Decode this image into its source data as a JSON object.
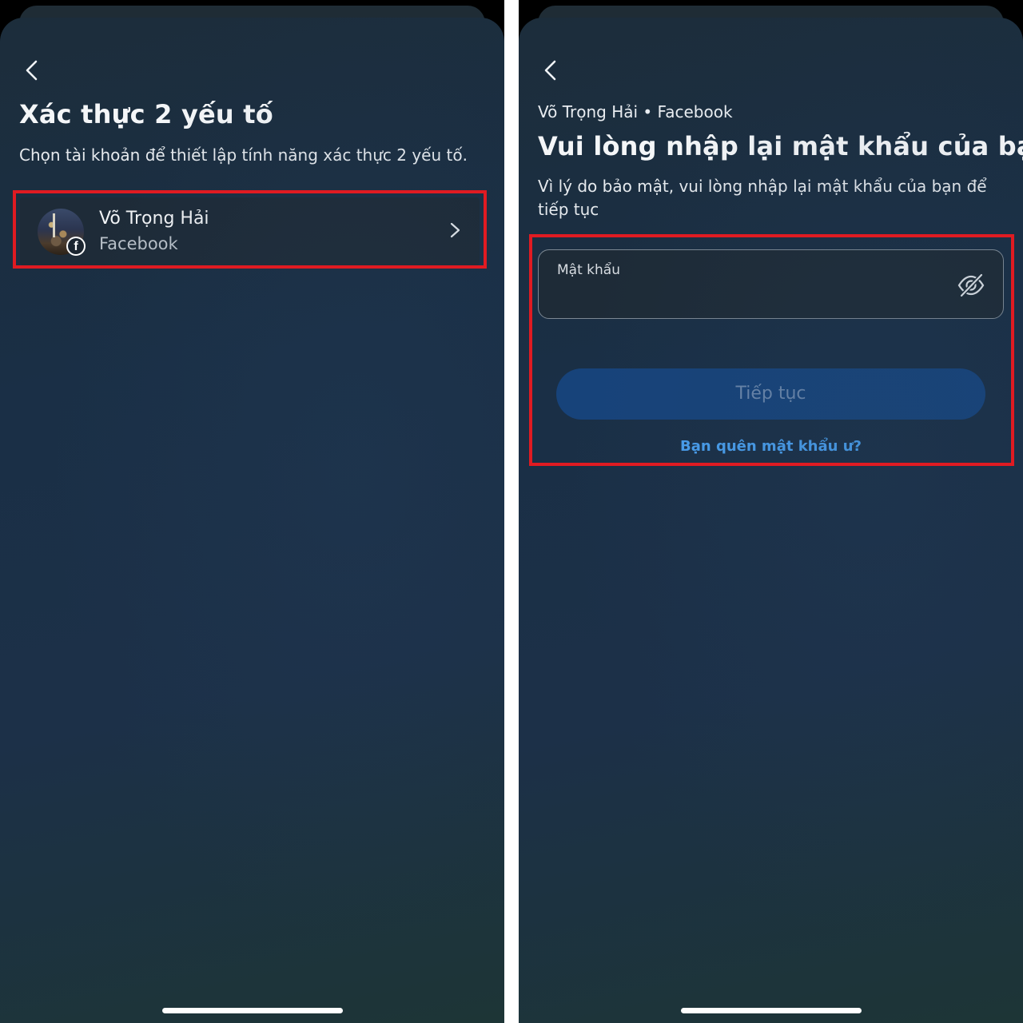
{
  "left_screen": {
    "back_label": "‹",
    "title": "Xác thực 2 yếu tố",
    "subtitle": "Chọn tài khoản để thiết lập tính năng xác thực 2 yếu tố.",
    "account": {
      "name": "Võ Trọng Hải",
      "platform": "Facebook",
      "badge_glyph": "f"
    }
  },
  "right_screen": {
    "breadcrumb": "Võ Trọng Hải • Facebook",
    "title": "Vui lòng nhập lại mật khẩu của bạn",
    "subtitle": "Vì lý do bảo mật, vui lòng nhập lại mật khẩu của bạn để tiếp tục",
    "password_label": "Mật khẩu",
    "password_value": "",
    "continue_label": "Tiếp tục",
    "forgot_label": "Bạn quên mật khẩu ư?"
  },
  "colors": {
    "highlight": "#e01b22",
    "button_fill": "#17437a",
    "link": "#4aa0f0"
  },
  "icons": [
    "back-chevron-icon",
    "chevron-right-icon",
    "facebook-icon",
    "eye-slash-icon"
  ]
}
